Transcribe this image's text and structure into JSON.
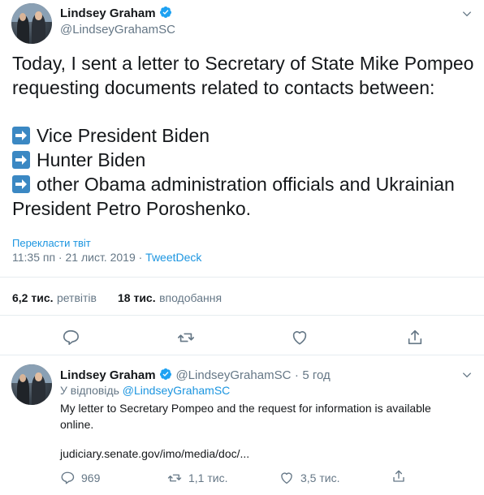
{
  "main_tweet": {
    "author_name": "Lindsey Graham",
    "author_handle": "@LindseyGrahamSC",
    "text_intro_line1": "Today, I sent a letter to Secretary of State Mike Pompeo",
    "text_intro_line2": "requesting documents related to contacts between:",
    "bullets": [
      "Vice President Biden",
      "Hunter Biden",
      "other Obama administration officials and Ukrainian"
    ],
    "bullet_continuation": "President Petro Poroshenko.",
    "bullet_emoji": "arrow-right-emoji",
    "translate_label": "Перекласти твіт",
    "timestamp": "11:35 пп · 21 лист. 2019 · ",
    "source": "TweetDeck",
    "retweets_count": "6,2 тис.",
    "retweets_label": "ретвітів",
    "likes_count": "18 тис.",
    "likes_label": "вподобання"
  },
  "reply_tweet": {
    "author_name": "Lindsey Graham",
    "author_handle": "@LindseyGrahamSC",
    "age": "5 год",
    "replying_to_label": "У відповідь",
    "replying_to_handle": "@LindseyGrahamSC",
    "text_line1": "My letter to Secretary Pompeo and the request for information is available",
    "text_line2": "online.",
    "link": "judiciary.senate.gov/imo/media/doc/...",
    "reply_count": "969",
    "retweet_count": "1,1 тис.",
    "like_count": "3,5 тис."
  },
  "colors": {
    "link": "#1b95e0",
    "secondary_text": "#657786",
    "verified": "#1da1f2",
    "divider": "#e6ecf0"
  }
}
